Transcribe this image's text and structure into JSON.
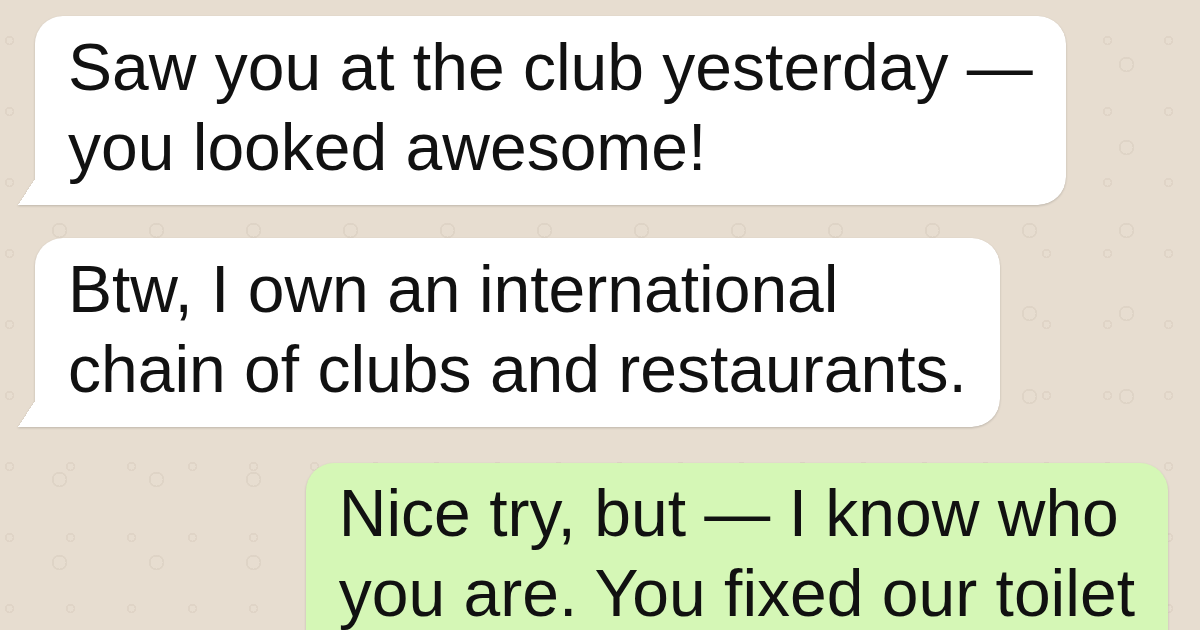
{
  "messages": [
    {
      "kind": "incoming",
      "text": "Saw you at the club yesterday —\nyou looked awesome!"
    },
    {
      "kind": "incoming",
      "text": "Btw, I own an international\nchain of clubs and restaurants."
    },
    {
      "kind": "outgoing",
      "text": "Nice try, but — I know who\nyou are. You fixed our toilet"
    }
  ]
}
